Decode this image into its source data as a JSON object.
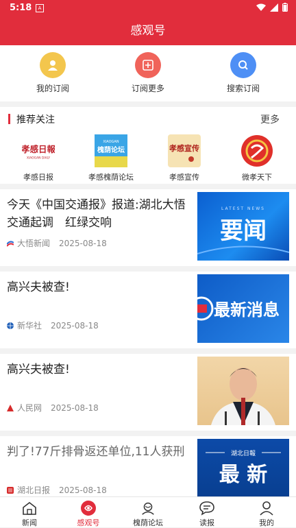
{
  "status_bar": {
    "time": "5:18",
    "sim_label": "A"
  },
  "app_bar": {
    "title": "感观号"
  },
  "subscribe_actions": [
    {
      "label": "我的订阅",
      "icon": "user-icon",
      "color": "#f3c64d"
    },
    {
      "label": "订阅更多",
      "icon": "add-icon",
      "color": "#f0635a"
    },
    {
      "label": "搜索订阅",
      "icon": "search-icon",
      "color": "#4e8ff5"
    }
  ],
  "recommended": {
    "title": "推荐关注",
    "more": "更多",
    "items": [
      {
        "label": "孝感日报",
        "logo_text": "孝感日報",
        "logo_sub": "XIAOGAN DAILY"
      },
      {
        "label": "孝感槐荫论坛",
        "logo_text": "槐荫论坛",
        "logo_sub": "XIAOGAN"
      },
      {
        "label": "孝感宣传",
        "logo_text": "孝感宣传"
      },
      {
        "label": "微孝天下"
      }
    ]
  },
  "news": [
    {
      "title": "今天《中国交通报》报道:湖北大悟交通起调　红绿交响",
      "source": "大悟新闻",
      "date": "2025-08-18",
      "thumb_text": "要闻",
      "thumb_sub": "LATEST NEWS"
    },
    {
      "title": "高兴夫被查!",
      "source": "新华社",
      "date": "2025-08-18",
      "thumb_text": "最新消息"
    },
    {
      "title": "高兴夫被查!",
      "source": "人民网",
      "date": "2025-08-18",
      "thumb_text": ""
    },
    {
      "title": "判了!77斤排骨返还单位,11人获刑",
      "source": "湖北日报",
      "date": "2025-08-18",
      "thumb_text": "最 新",
      "thumb_sub": "湖北日報"
    }
  ],
  "tabs": [
    {
      "label": "新闻",
      "icon": "home-icon"
    },
    {
      "label": "感观号",
      "icon": "ganguan-icon",
      "active": true
    },
    {
      "label": "槐荫论坛",
      "icon": "forum-icon"
    },
    {
      "label": "读报",
      "icon": "newspaper-chat-icon"
    },
    {
      "label": "我的",
      "icon": "profile-icon"
    }
  ],
  "colors": {
    "brand": "#e12d3c"
  }
}
